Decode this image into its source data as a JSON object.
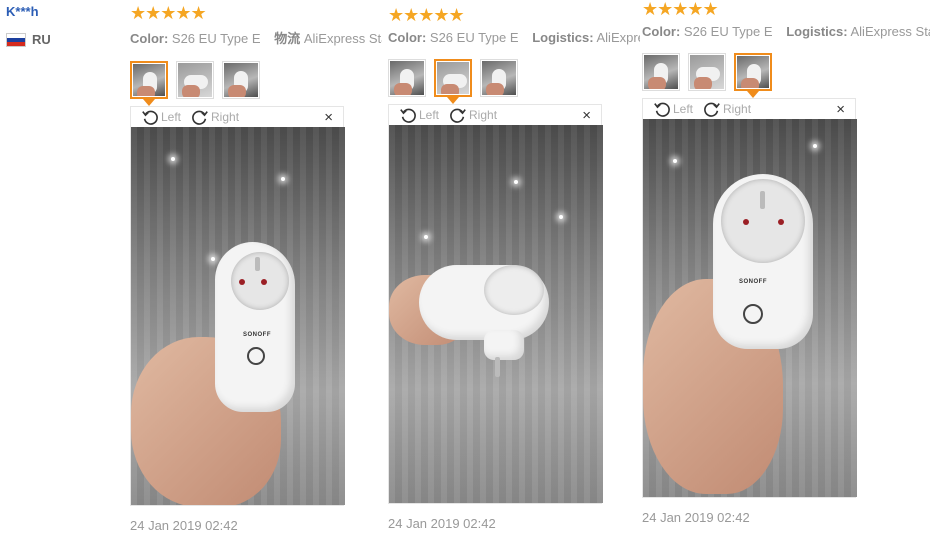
{
  "user": {
    "name": "K***h",
    "country": "RU"
  },
  "reviews": [
    {
      "stars": "★★★★★",
      "color_label": "Color:",
      "color_value": "S26 EU Type E",
      "extra_label": "物流",
      "extra_value": "AliExpress Sta",
      "rotate_left": "Left",
      "rotate_right": "Right",
      "close": "×",
      "date": "24 Jan 2019 02:42"
    },
    {
      "stars": "★★★★★",
      "color_label": "Color:",
      "color_value": "S26 EU Type E",
      "extra_label": "Logistics:",
      "extra_value": "AliExpres",
      "rotate_left": "Left",
      "rotate_right": "Right",
      "close": "×",
      "date": "24 Jan 2019 02:42"
    },
    {
      "stars": "★★★★★",
      "color_label": "Color:",
      "color_value": "S26 EU Type E",
      "extra_label": "Logistics:",
      "extra_value": "AliExpress Stan",
      "rotate_left": "Left",
      "rotate_right": "Right",
      "close": "×",
      "date": "24 Jan 2019 02:42"
    }
  ],
  "plug_brand": "SONOFF",
  "colors": {
    "accent": "#f08c1b",
    "star": "#f5a623",
    "username": "#2b5db5"
  },
  "icons": {
    "rotate_left": "rotate-left-icon",
    "rotate_right": "rotate-right-icon",
    "close": "close-icon"
  },
  "selected_thumbs": [
    1,
    2,
    3
  ]
}
